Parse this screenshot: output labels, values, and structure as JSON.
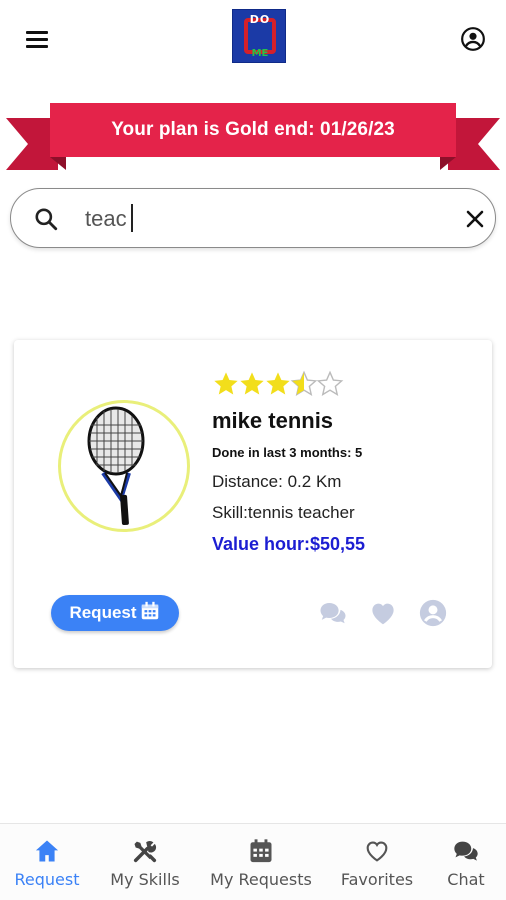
{
  "header": {
    "logo_top_text": "DO",
    "logo_bottom_text": "ME",
    "menu_icon": "hamburger-menu-icon",
    "profile_icon": "account-circle-icon"
  },
  "banner": {
    "text": "Your plan is Gold end: 01/26/23",
    "color": "#e4234a"
  },
  "search": {
    "value": "teac",
    "icon": "search-icon",
    "clear_icon": "close-icon"
  },
  "result_card": {
    "rating": 3.5,
    "rating_max": 5,
    "name": "mike tennis",
    "done_text": "Done in last 3 months: 5",
    "distance_text": "Distance: 0.2 Km",
    "skill_text": "Skill:tennis teacher",
    "value_text": "Value hour:$50,55",
    "request_label": "Request",
    "image": "tennis-racket"
  },
  "bottom_nav": {
    "items": [
      {
        "label": "Request",
        "icon": "home-icon",
        "active": true
      },
      {
        "label": "My Skills",
        "icon": "tools-icon",
        "active": false
      },
      {
        "label": "My Requests",
        "icon": "calendar-icon",
        "active": false
      },
      {
        "label": "Favorites",
        "icon": "heart-outline-icon",
        "active": false
      },
      {
        "label": "Chat",
        "icon": "chat-bubbles-icon",
        "active": false
      }
    ]
  },
  "colors": {
    "accent": "#3b82f6",
    "banner": "#e4234a",
    "star": "#f2de1b",
    "value_text": "#1c1ed2",
    "inactive_action": "#c5cce0"
  }
}
